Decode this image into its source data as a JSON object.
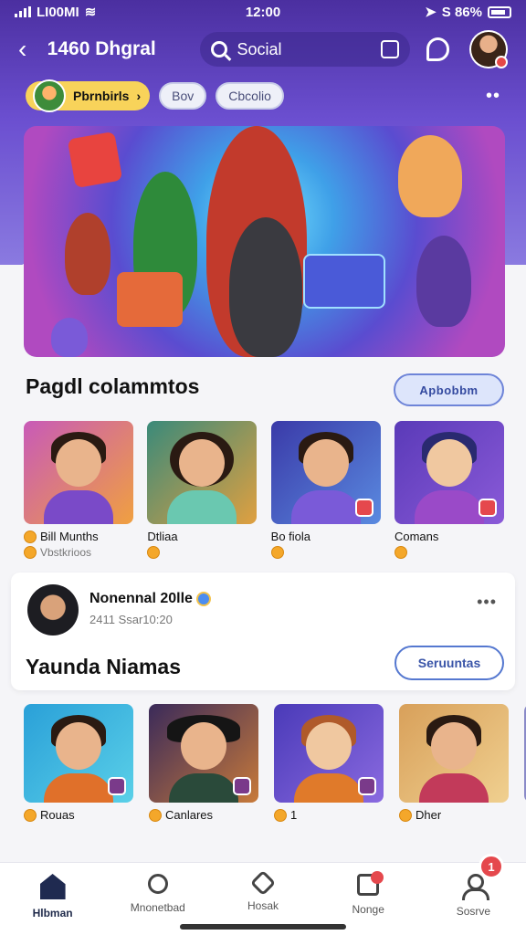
{
  "status_bar": {
    "carrier": "LI00MI",
    "time": "12:00",
    "battery": "S 86%"
  },
  "top_nav": {
    "title": "1460 Dhgral",
    "search_label": "Social"
  },
  "chips": {
    "main": "Pbrnbirls",
    "chip1": "Bov",
    "chip2": "Cbcolio"
  },
  "section1": {
    "title": "Pagdl colammtos",
    "button": "Apbobbm"
  },
  "cards1": [
    {
      "name": "Bill Munths",
      "sub": "Vbstkrioos"
    },
    {
      "name": "Dtliaa"
    },
    {
      "name": "Bo fiola"
    },
    {
      "name": "Comans"
    }
  ],
  "post": {
    "author": "Nonennal 20lle",
    "time": "2411 Ssar10:20",
    "title": "Yaunda Niamas",
    "button": "Seruuntas"
  },
  "cards2": [
    {
      "name": "Rouas"
    },
    {
      "name": "Canlares"
    },
    {
      "name": "1"
    },
    {
      "name": "Dher"
    }
  ],
  "bottom_nav": [
    {
      "label": "Hlbman",
      "icon": "home-icon"
    },
    {
      "label": "Mnonetbad",
      "icon": "search-icon"
    },
    {
      "label": "Hosak",
      "icon": "compass-icon"
    },
    {
      "label": "Nonge",
      "icon": "message-icon"
    },
    {
      "label": "Sosrve",
      "icon": "profile-icon"
    }
  ],
  "fab_badge": "1",
  "colors": {
    "accent": "#5a3fc0",
    "badge": "#e5484d",
    "coin": "#f4a72a"
  }
}
